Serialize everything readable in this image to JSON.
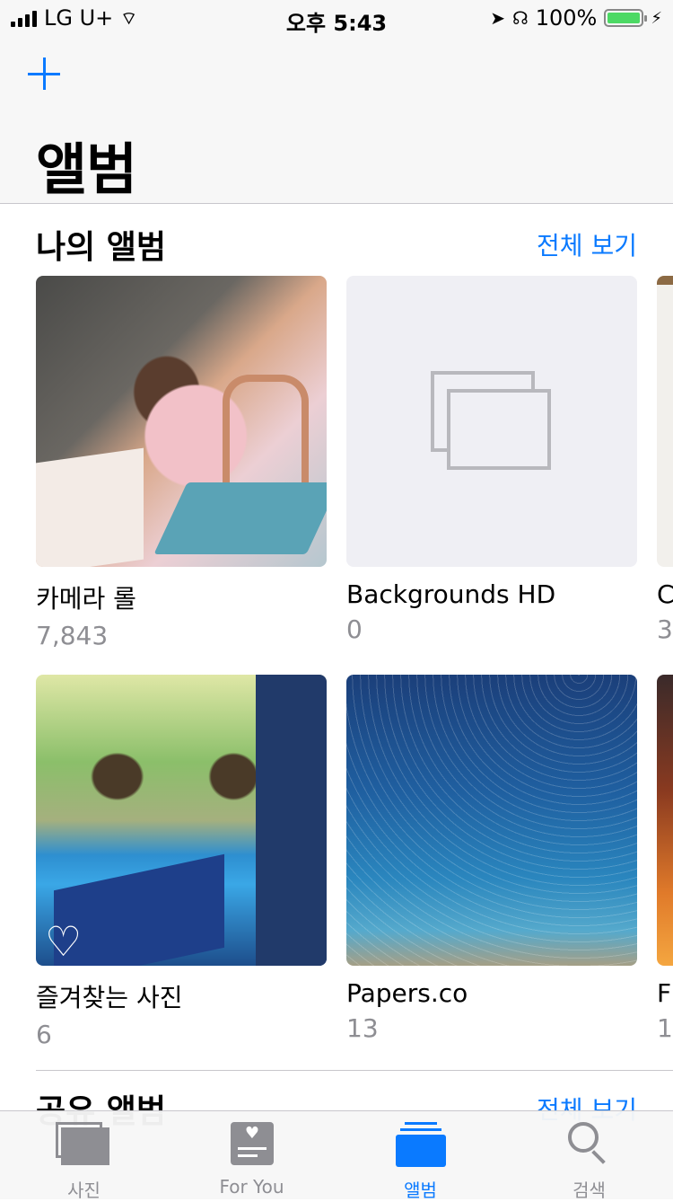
{
  "status_bar": {
    "carrier": "LG U+",
    "time": "오후 5:43",
    "battery": "100%",
    "battery_level": 1.0
  },
  "header": {
    "title": "앨범",
    "add_icon": "plus-icon"
  },
  "my_albums": {
    "title": "나의 앨범",
    "see_all": "전체 보기",
    "albums": [
      {
        "name": "카메라 롤",
        "count": "7,843"
      },
      {
        "name": "Backgrounds HD",
        "count": "0"
      },
      {
        "name": "C",
        "count": "3"
      },
      {
        "name": "즐겨찾는 사진",
        "count": "6"
      },
      {
        "name": "Papers.co",
        "count": "13"
      },
      {
        "name": "F",
        "count": "1"
      }
    ]
  },
  "shared_albums": {
    "title": "공유 앨범",
    "see_all": "전체 보기"
  },
  "tab_bar": {
    "tabs": [
      {
        "label": "사진",
        "icon": "photos-icon"
      },
      {
        "label": "For You",
        "icon": "for-you-icon"
      },
      {
        "label": "앨범",
        "icon": "albums-icon",
        "active": true
      },
      {
        "label": "검색",
        "icon": "search-icon"
      }
    ]
  },
  "colors": {
    "accent": "#0a7aff",
    "secondary_text": "#8e8e93",
    "battery_green": "#4cd964"
  }
}
